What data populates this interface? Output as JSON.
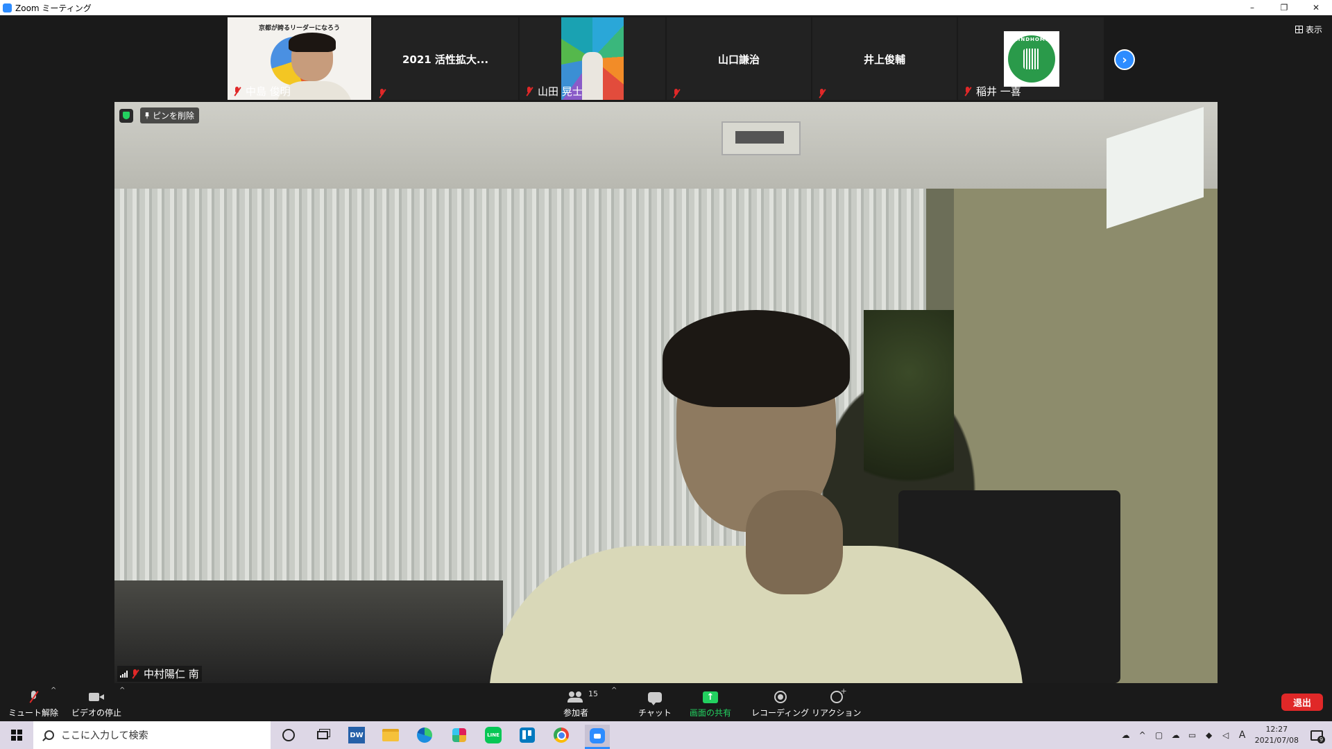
{
  "window": {
    "title": "Zoom ミーティング",
    "controls": [
      "–",
      "❐",
      "✕"
    ]
  },
  "view_button": {
    "label": "表示"
  },
  "participant_strip": [
    {
      "name": "中島 俊明",
      "type": "video",
      "muted": true
    },
    {
      "name": "2021 活性拡大...",
      "type": "name-only",
      "muted": true
    },
    {
      "name": "山田 晃士",
      "type": "video",
      "muted": true
    },
    {
      "name": "山口謙治",
      "type": "name-only",
      "muted": true
    },
    {
      "name": "井上俊輔",
      "type": "name-only",
      "muted": true
    },
    {
      "name": "稲井 一喜",
      "type": "logo",
      "muted": true
    }
  ],
  "thumb_text": {
    "nakajima_slide_title": "京都が誇るリーダーになろう",
    "logo_text": "KINDHOME"
  },
  "main_video": {
    "unpin_label": "ピンを削除",
    "speaker_name": "中村陽仁 南"
  },
  "toolbar": {
    "mute_label": "ミュート解除",
    "video_label": "ビデオの停止",
    "participants_label": "参加者",
    "participants_count": "15",
    "chat_label": "チャット",
    "share_label": "画面の共有",
    "record_label": "レコーディング",
    "reaction_label": "リアクション",
    "leave_label": "退出"
  },
  "taskbar": {
    "search_placeholder": "ここに入力して検索",
    "clock_time": "12:27",
    "clock_date": "2021/07/08",
    "ime_label": "A",
    "notification_count": "9",
    "pinned_apps": [
      "cortana-icon",
      "task-view-icon",
      "dreamweaver-icon",
      "file-explorer-icon",
      "edge-icon",
      "slack-icon",
      "line-icon",
      "trello-icon",
      "chrome-icon",
      "zoom-icon"
    ]
  },
  "colors": {
    "zoom_blue": "#2d8cff",
    "share_green": "#23d160",
    "leave_red": "#e02828",
    "muted_red": "#e02828"
  }
}
